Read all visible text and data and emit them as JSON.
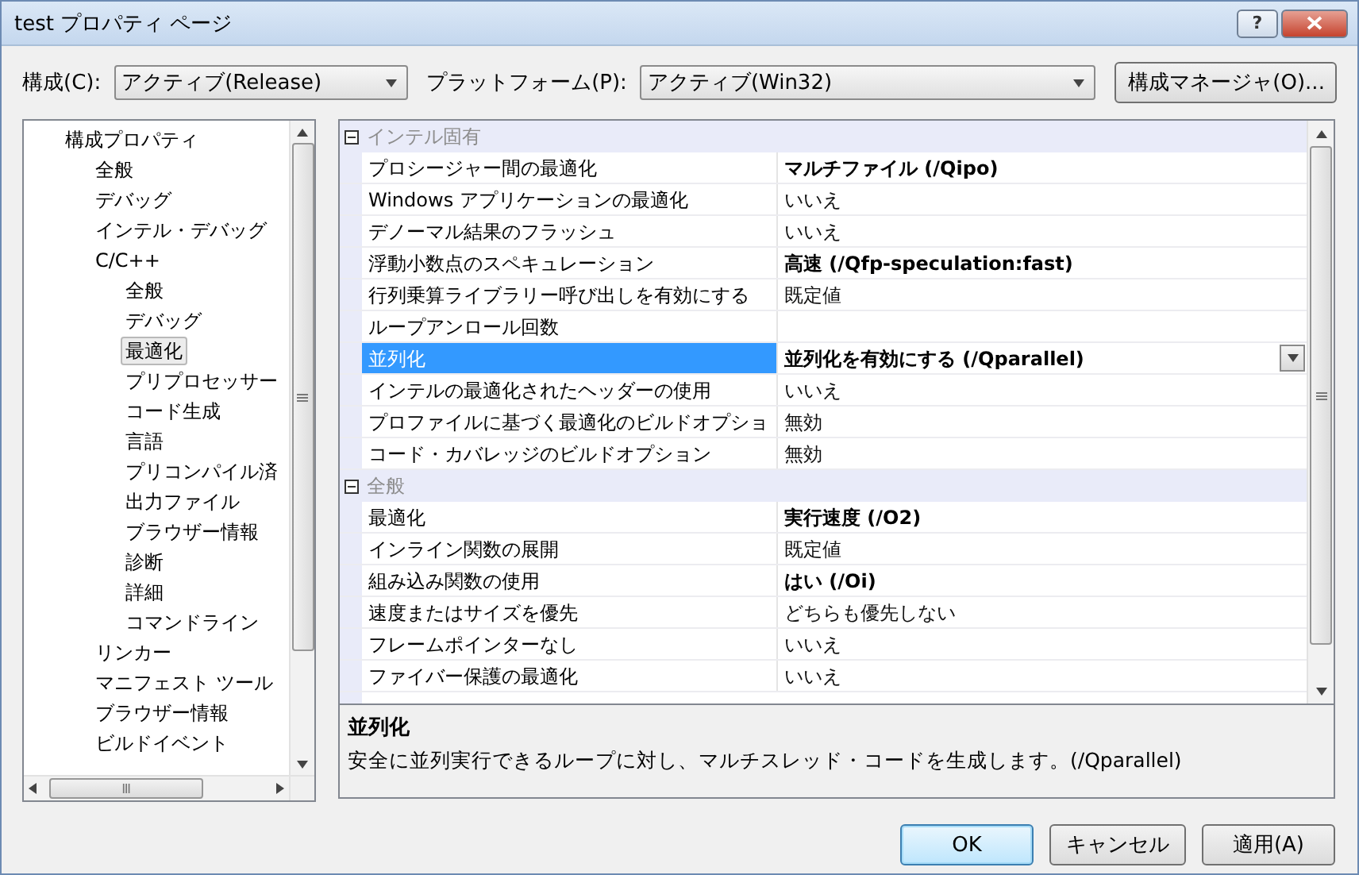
{
  "window": {
    "title": "test プロパティ ページ",
    "help_button": "?"
  },
  "toolbar": {
    "config_label": "構成(C):",
    "config_value": "アクティブ(Release)",
    "platform_label": "プラットフォーム(P):",
    "platform_value": "アクティブ(Win32)",
    "manager_button": "構成マネージャ(O)..."
  },
  "tree": [
    {
      "label": "構成プロパティ",
      "selected": false,
      "children": [
        {
          "label": "全般",
          "selected": false
        },
        {
          "label": "デバッグ",
          "selected": false
        },
        {
          "label": "インテル・デバッグ",
          "selected": false
        },
        {
          "label": "C/C++",
          "selected": false,
          "children": [
            {
              "label": "全般",
              "selected": false
            },
            {
              "label": "デバッグ",
              "selected": false
            },
            {
              "label": "最適化",
              "selected": true
            },
            {
              "label": "プリプロセッサー",
              "selected": false
            },
            {
              "label": "コード生成",
              "selected": false
            },
            {
              "label": "言語",
              "selected": false
            },
            {
              "label": "プリコンパイル済",
              "selected": false
            },
            {
              "label": "出力ファイル",
              "selected": false
            },
            {
              "label": "ブラウザー情報",
              "selected": false
            },
            {
              "label": "診断",
              "selected": false
            },
            {
              "label": "詳細",
              "selected": false
            },
            {
              "label": "コマンドライン",
              "selected": false
            }
          ]
        },
        {
          "label": "リンカー",
          "selected": false
        },
        {
          "label": "マニフェスト ツール",
          "selected": false
        },
        {
          "label": "ブラウザー情報",
          "selected": false
        },
        {
          "label": "ビルドイベント",
          "selected": false
        }
      ]
    }
  ],
  "grid": [
    {
      "category": "インテル固有",
      "expanded": true,
      "rows": [
        {
          "name": "プロシージャー間の最適化",
          "value": "マルチファイル (/Qipo)",
          "modified": true,
          "selected": false
        },
        {
          "name": "Windows アプリケーションの最適化",
          "value": "いいえ",
          "modified": false,
          "selected": false
        },
        {
          "name": "デノーマル結果のフラッシュ",
          "value": "いいえ",
          "modified": false,
          "selected": false
        },
        {
          "name": "浮動小数点のスペキュレーション",
          "value": "高速 (/Qfp-speculation:fast)",
          "modified": true,
          "selected": false
        },
        {
          "name": "行列乗算ライブラリー呼び出しを有効にする",
          "value": "既定値",
          "modified": false,
          "selected": false
        },
        {
          "name": "ループアンロール回数",
          "selected": false
        },
        {
          "name": "並列化",
          "value": "並列化を有効にする (/Qparallel)",
          "modified": true,
          "selected": true
        },
        {
          "name": "インテルの最適化されたヘッダーの使用",
          "value": "いいえ",
          "modified": false,
          "selected": false
        },
        {
          "name": "プロファイルに基づく最適化のビルドオプショ",
          "value": "無効",
          "modified": false,
          "selected": false
        },
        {
          "name": "コード・カバレッジのビルドオプション",
          "value": "無効",
          "modified": false,
          "selected": false
        }
      ]
    },
    {
      "category": "全般",
      "expanded": true,
      "rows": [
        {
          "name": "最適化",
          "value": "実行速度 (/O2)",
          "modified": true,
          "selected": false
        },
        {
          "name": "インライン関数の展開",
          "value": "既定値",
          "modified": false,
          "selected": false
        },
        {
          "name": "組み込み関数の使用",
          "value": "はい (/Oi)",
          "modified": true,
          "selected": false
        },
        {
          "name": "速度またはサイズを優先",
          "value": "どちらも優先しない",
          "modified": false,
          "selected": false
        },
        {
          "name": "フレームポインターなし",
          "value": "いいえ",
          "modified": false,
          "selected": false
        },
        {
          "name": "ファイバー保護の最適化",
          "value": "いいえ",
          "modified": false,
          "selected": false
        }
      ]
    }
  ],
  "description": {
    "title": "並列化",
    "text": "安全に並列実行できるループに対し、マルチスレッド・コードを生成します。(/Qparallel)"
  },
  "buttons": [
    {
      "label": "OK",
      "default": true
    },
    {
      "label": "キャンセル",
      "default": false
    },
    {
      "label": "適用(A)",
      "default": false
    }
  ]
}
